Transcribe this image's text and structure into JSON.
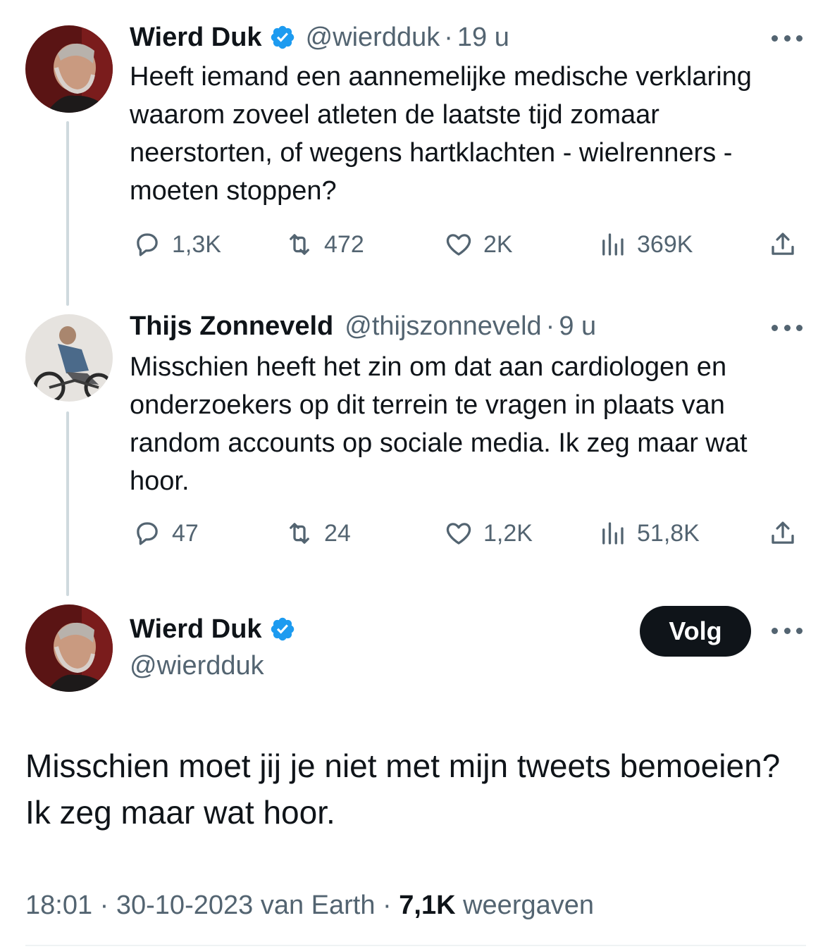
{
  "colors": {
    "verified_badge": "#1d9bf0",
    "text_primary": "#0f1419",
    "text_secondary": "#536471",
    "thread_line": "#cfd9de",
    "follow_button_bg": "#0f1419"
  },
  "tweets": [
    {
      "author_name": "Wierd Duk",
      "verified": true,
      "handle": "@wierdduk",
      "separator": "·",
      "time": "19 u",
      "text": "Heeft iemand een aannemelijke medische verklaring waarom zoveel atleten de laatste tijd zomaar neerstorten, of wegens hartklachten - wielrenners - moeten stoppen?",
      "replies": "1,3K",
      "retweets": "472",
      "likes": "2K",
      "views": "369K"
    },
    {
      "author_name": "Thijs Zonneveld",
      "verified": false,
      "handle": "@thijszonneveld",
      "separator": "·",
      "time": "9 u",
      "text": "Misschien heeft het zin om dat aan cardiologen en onderzoekers op dit terrein te vragen in plaats van random accounts op sociale media. Ik zeg maar wat hoor.",
      "replies": "47",
      "retweets": "24",
      "likes": "1,2K",
      "views": "51,8K"
    }
  ],
  "main_tweet": {
    "author_name": "Wierd Duk",
    "verified": true,
    "handle": "@wierdduk",
    "follow_label": "Volg",
    "text": "Misschien moet jij je niet met mijn tweets bemoeien? Ik zeg maar wat hoor.",
    "time": "18:01",
    "separator": "·",
    "date": "30-10-2023",
    "source": "van Earth",
    "views_count": "7,1K",
    "views_label": "weergaven"
  },
  "icons": {
    "reply": "speech-bubble-icon",
    "retweet": "retweet-icon",
    "like": "heart-icon",
    "views": "bar-chart-icon",
    "share": "share-icon",
    "more": "more-dots-icon",
    "verified": "verified-badge-icon"
  }
}
